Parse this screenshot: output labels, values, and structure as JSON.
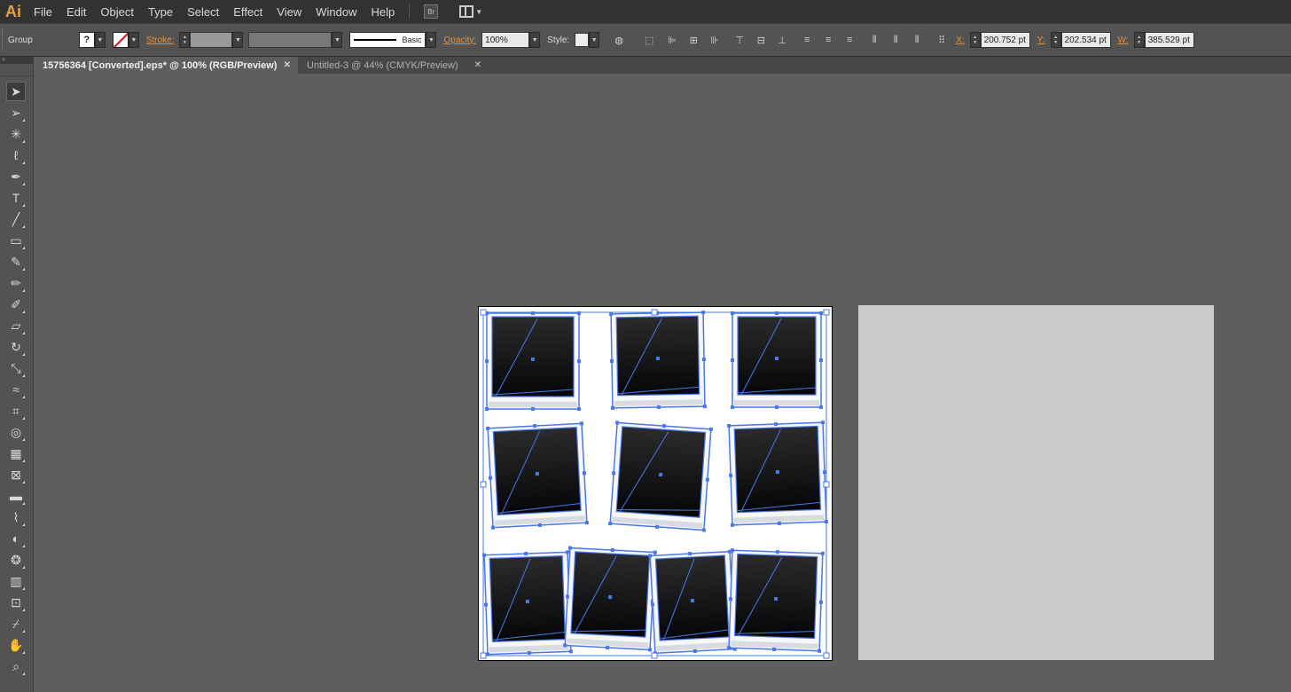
{
  "app": {
    "logo": "Ai",
    "bridge_label": "Br"
  },
  "menu": [
    "File",
    "Edit",
    "Object",
    "Type",
    "Select",
    "Effect",
    "View",
    "Window",
    "Help"
  ],
  "control": {
    "selection_type": "Group",
    "fill_label": "?",
    "stroke_label": "Stroke:",
    "profile_label": "Basic",
    "opacity_label": "Opacity:",
    "opacity_value": "100%",
    "style_label": "Style:",
    "x_label": "X:",
    "x_value": "200.752 pt",
    "y_label": "Y:",
    "y_value": "202.534 pt",
    "w_label": "W:",
    "w_value": "385.529 pt"
  },
  "tabs": [
    {
      "label": "15756364 [Converted].eps* @ 100% (RGB/Preview)",
      "active": true
    },
    {
      "label": "Untitled-3 @ 44% (CMYK/Preview)",
      "active": false
    }
  ],
  "tools": [
    "selection-tool",
    "direct-selection-tool",
    "magic-wand-tool",
    "lasso-tool",
    "pen-tool",
    "type-tool",
    "line-segment-tool",
    "rectangle-tool",
    "paintbrush-tool",
    "pencil-tool",
    "blob-brush-tool",
    "eraser-tool",
    "rotate-tool",
    "scale-tool",
    "width-tool",
    "free-transform-tool",
    "shape-builder-tool",
    "perspective-grid-tool",
    "mesh-tool",
    "gradient-tool",
    "eyedropper-tool",
    "blend-tool",
    "symbol-sprayer-tool",
    "column-graph-tool",
    "artboard-tool",
    "slice-tool",
    "hand-tool",
    "zoom-tool"
  ],
  "colors": {
    "selection": "#4a78e8",
    "accent": "#e8903a",
    "canvas": "#5e5e5e"
  }
}
